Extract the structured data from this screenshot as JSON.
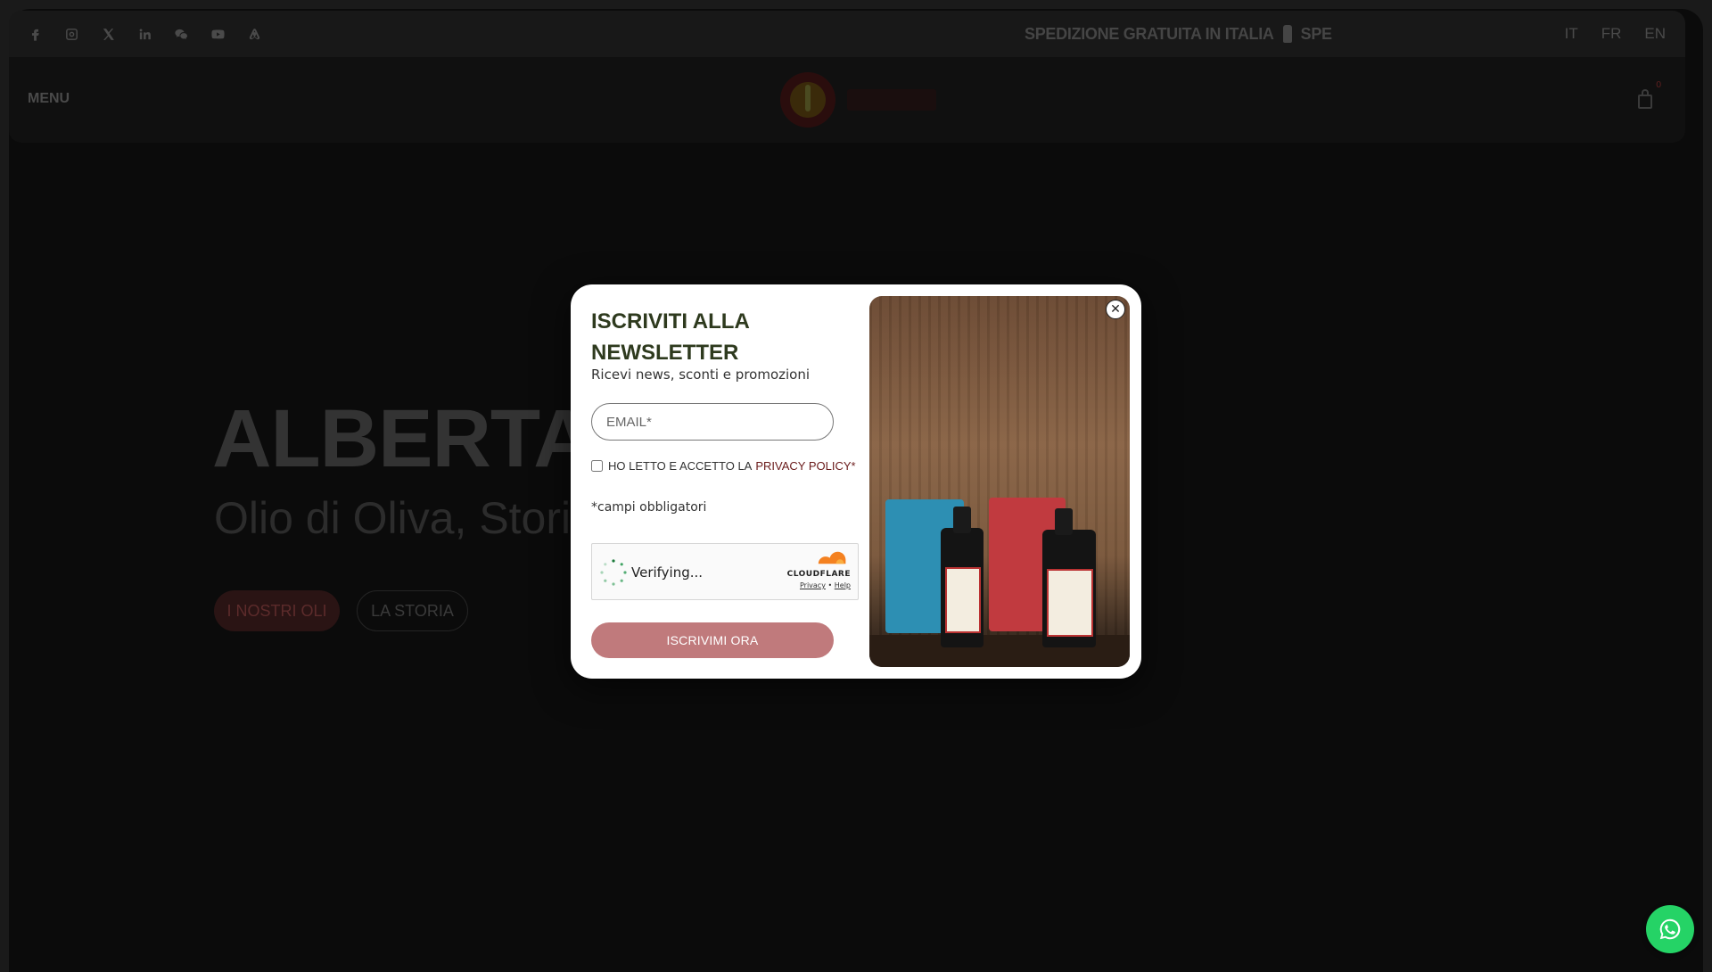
{
  "topbar": {
    "social_icons": [
      "facebook-icon",
      "instagram-icon",
      "x-icon",
      "linkedin-icon",
      "wechat-icon",
      "youtube-icon",
      "airbnb-icon"
    ],
    "promo_text": "SPEDIZIONE GRATUITA IN ITALIA",
    "promo_text_repeat": "SPE",
    "languages": [
      "IT",
      "FR",
      "EN"
    ]
  },
  "header": {
    "menu_label": "MENU",
    "cart_count": "0"
  },
  "hero": {
    "title": "ALBERTA IA",
    "subtitle": "Olio di Oliva, Storia e",
    "btn_olii": "I NOSTRI OLI",
    "btn_storia": "LA STORIA"
  },
  "modal": {
    "title": "ISCRIVITI ALLA NEWSLETTER",
    "subtitle": "Ricevi news, sconti e promozioni",
    "email_placeholder": "EMAIL*",
    "privacy_prefix": "HO LETTO E ACCETTO LA",
    "privacy_link": "PRIVACY POLICY*",
    "required_note": "*campi obbligatori",
    "turnstile": {
      "status": "Verifying...",
      "brand": "CLOUDFLARE",
      "privacy": "Privacy",
      "separator": "•",
      "help": "Help"
    },
    "submit": "ISCRIVIMI ORA",
    "close_label": "✕"
  },
  "colors": {
    "accent_red": "#6a1a1a",
    "button_pink": "#c07a7c",
    "title_green": "#2e3a1e",
    "whatsapp_green": "#25d366"
  }
}
